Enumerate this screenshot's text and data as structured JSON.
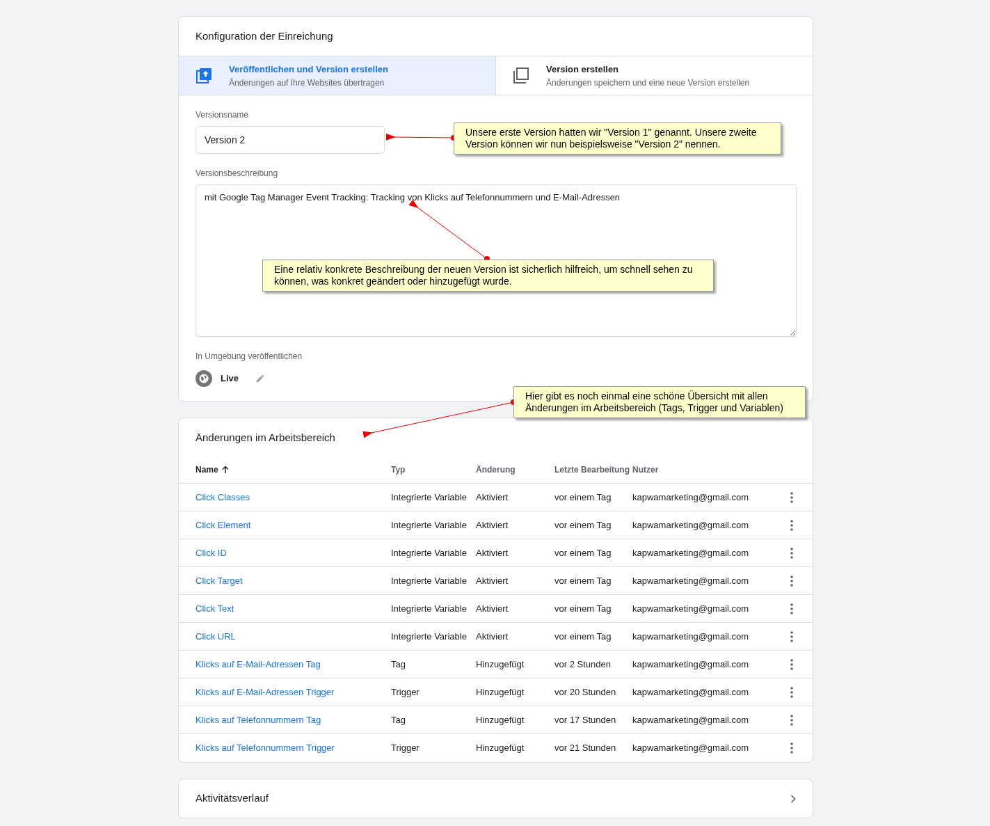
{
  "submission": {
    "title": "Konfiguration der Einreichung",
    "tabs": [
      {
        "kind": "publish",
        "label": "Veröffentlichen und Version erstellen",
        "description": "Änderungen auf Ihre Websites übertragen",
        "selected": true
      },
      {
        "kind": "version",
        "label": "Version erstellen",
        "description": "Änderungen speichern und eine neue Version erstellen",
        "selected": false
      }
    ],
    "version_name": {
      "label": "Versionsname",
      "value": "Version 2"
    },
    "version_description": {
      "label": "Versionsbeschreibung",
      "value": "mit Google Tag Manager Event Tracking: Tracking von Klicks auf Telefonnummern und E-Mail-Adressen"
    },
    "environment": {
      "label": "In Umgebung veröffentlichen",
      "value": "Live"
    }
  },
  "workspace_changes": {
    "title": "Änderungen im Arbeitsbereich",
    "columns": [
      {
        "label": "Name",
        "sorted": true
      },
      {
        "label": "Typ",
        "sorted": false
      },
      {
        "label": "Änderung",
        "sorted": false
      },
      {
        "label": "Letzte Bearbeitung",
        "sorted": false
      },
      {
        "label": "Nutzer",
        "sorted": false
      }
    ],
    "rows": [
      {
        "name": "Click Classes",
        "type": "Integrierte Variable",
        "change": "Aktiviert",
        "edited": "vor einem Tag",
        "user": "kapwamarketing@gmail.com"
      },
      {
        "name": "Click Element",
        "type": "Integrierte Variable",
        "change": "Aktiviert",
        "edited": "vor einem Tag",
        "user": "kapwamarketing@gmail.com"
      },
      {
        "name": "Click ID",
        "type": "Integrierte Variable",
        "change": "Aktiviert",
        "edited": "vor einem Tag",
        "user": "kapwamarketing@gmail.com"
      },
      {
        "name": "Click Target",
        "type": "Integrierte Variable",
        "change": "Aktiviert",
        "edited": "vor einem Tag",
        "user": "kapwamarketing@gmail.com"
      },
      {
        "name": "Click Text",
        "type": "Integrierte Variable",
        "change": "Aktiviert",
        "edited": "vor einem Tag",
        "user": "kapwamarketing@gmail.com"
      },
      {
        "name": "Click URL",
        "type": "Integrierte Variable",
        "change": "Aktiviert",
        "edited": "vor einem Tag",
        "user": "kapwamarketing@gmail.com"
      },
      {
        "name": "Klicks auf E-Mail-Adressen Tag",
        "type": "Tag",
        "change": "Hinzugefügt",
        "edited": "vor 2 Stunden",
        "user": "kapwamarketing@gmail.com"
      },
      {
        "name": "Klicks auf E-Mail-Adressen Trigger",
        "type": "Trigger",
        "change": "Hinzugefügt",
        "edited": "vor 20 Stunden",
        "user": "kapwamarketing@gmail.com"
      },
      {
        "name": "Klicks auf Telefonnummern Tag",
        "type": "Tag",
        "change": "Hinzugefügt",
        "edited": "vor 17 Stunden",
        "user": "kapwamarketing@gmail.com"
      },
      {
        "name": "Klicks auf Telefonnummern Trigger",
        "type": "Trigger",
        "change": "Hinzugefügt",
        "edited": "vor 21 Stunden",
        "user": "kapwamarketing@gmail.com"
      }
    ]
  },
  "activity_history": {
    "title": "Aktivitätsverlauf"
  },
  "annotations": [
    {
      "text": "Unsere erste Version hatten wir \"Version 1\" genannt. Unsere zweite Version können wir nun beispielsweise \"Version 2\" nennen."
    },
    {
      "text": "Eine relativ konkrete Beschreibung der neuen Version ist sicherlich hilfreich, um schnell sehen zu können, was konkret geändert oder hinzugefügt wurde."
    },
    {
      "text": "Hier gibt es noch einmal eine schöne Übersicht mit allen Änderungen im Arbeitsbereich (Tags, Trigger und Variablen)"
    }
  ]
}
